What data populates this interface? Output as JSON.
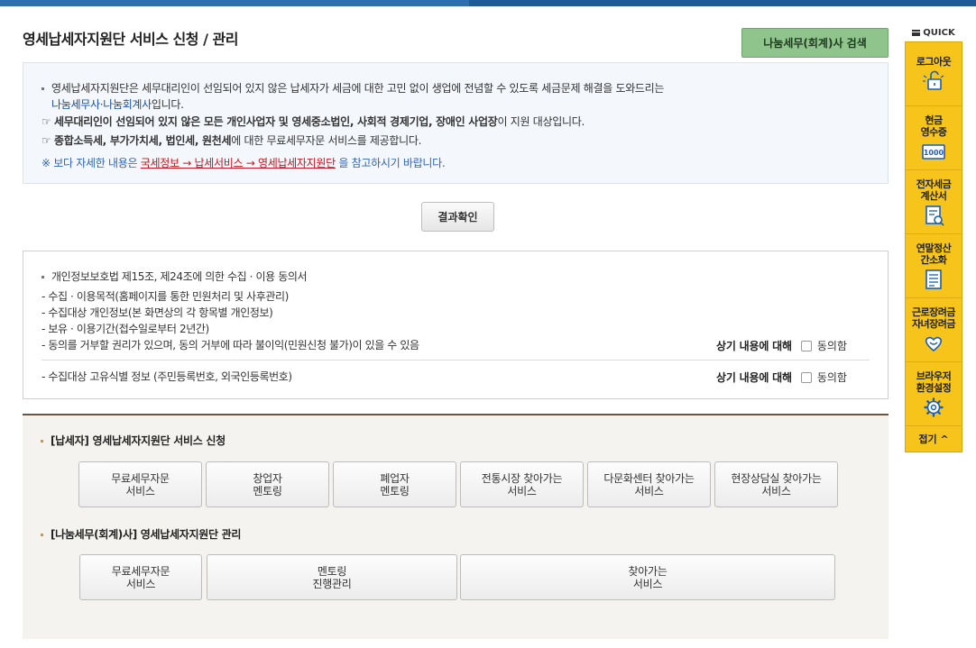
{
  "page": {
    "title": "영세납세자지원단 서비스 신청 / 관리",
    "search_button": "나눔세무(회계)사 검색",
    "result_button": "결과확인"
  },
  "info": {
    "line1": "영세납세자지원단은 세무대리인이 선임되어 있지 않은 납세자가 세금에 대한 고민 없이 생업에 전념할 수 있도록 세금문제 해결을 도와드리는",
    "line2_link": "나눔세무사·나눔회계사",
    "line2_tail": "입니다.",
    "line3_prefix": "☞ ",
    "line3_bold": "세무대리인이 선임되어 있지 않은 모든 개인사업자 및 영세중소법인, 사회적 경제기업, 장애인 사업장",
    "line3_tail": "이 지원 대상입니다.",
    "line4_prefix": "☞ ",
    "line4_bold": "종합소득세, 부가가치세, 법인세, 원천세",
    "line4_tail": "에 대한 무료세무자문 서비스를 제공합니다.",
    "note_prefix": "※ 보다 자세한 내용은 ",
    "note_link": "국세정보 → 납세서비스 → 영세납세자지원단",
    "note_tail": " 을 참고하시기 바랍니다."
  },
  "consent": {
    "heading": "개인정보보호법 제15조,  제24조에 의한 수집 · 이용 동의서",
    "items": [
      "- 수집 · 이용목적(홈페이지를 통한 민원처리 및 사후관리)",
      "- 수집대상 개인정보(본 화면상의 각 항목별 개인정보)",
      "- 보유 · 이용기간(접수일로부터 2년간)",
      "- 동의를 거부할 권리가 있으며, 동의 거부에 따라 불이익(민원신청 불가)이 있을 수 있음"
    ],
    "unique_id_item": "- 수집대상 고유식별 정보 (주민등록번호, 외국인등록번호)",
    "agree_label": "상기 내용에 대해",
    "agree_checkbox": "동의함"
  },
  "taxpayer_section": {
    "title": "[납세자] 영세납세자지원단 서비스 신청",
    "buttons": [
      {
        "line1": "무료세무자문",
        "line2": "서비스"
      },
      {
        "line1": "창업자",
        "line2": "멘토링"
      },
      {
        "line1": "폐업자",
        "line2": "멘토링"
      },
      {
        "line1": "전통시장 찾아가는",
        "line2": "서비스"
      },
      {
        "line1": "다문화센터 찾아가는",
        "line2": "서비스"
      },
      {
        "line1": "현장상담실 찾아가는",
        "line2": "서비스"
      }
    ]
  },
  "accountant_section": {
    "title": "[나눔세무(회계)사] 영세납세자지원단 관리",
    "buttons": [
      {
        "line1": "무료세무자문",
        "line2": "서비스"
      },
      {
        "line1": "멘토링",
        "line2": "진행관리"
      },
      {
        "line1": "찾아가는",
        "line2": "서비스"
      }
    ]
  },
  "quick": {
    "header": "QUICK",
    "items": [
      {
        "line1": "로그아웃",
        "line2": "",
        "icon": "unlock-icon"
      },
      {
        "line1": "현금",
        "line2": "영수증",
        "icon": "receipt-icon",
        "icon_text": "1000"
      },
      {
        "line1": "전자세금",
        "line2": "계산서",
        "icon": "invoice-icon"
      },
      {
        "line1": "연말정산",
        "line2": "간소화",
        "icon": "document-icon"
      },
      {
        "line1": "근로장려금",
        "line2": "자녀장려금",
        "icon": "heart-hands-icon"
      },
      {
        "line1": "브라우저",
        "line2": "환경설정",
        "icon": "gear-icon"
      }
    ],
    "close": "접기 ^"
  },
  "colors": {
    "topbar": "#1e5a96",
    "search_button": "#8fc48d",
    "quick_panel": "#f7c41b",
    "link_red": "#c0191e",
    "link_blue": "#1a4fa0"
  }
}
